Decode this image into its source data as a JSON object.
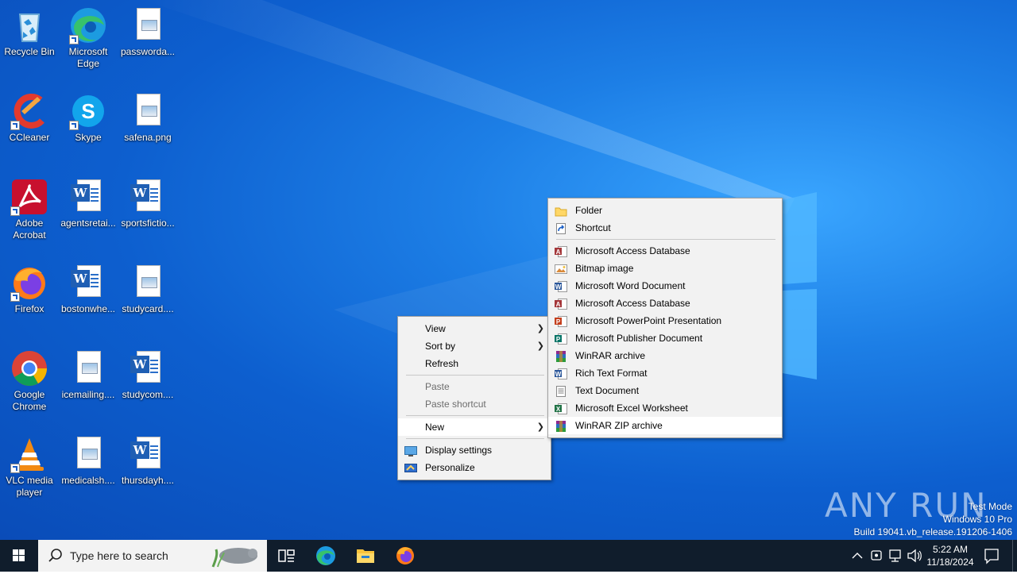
{
  "desktop": {
    "icons": [
      {
        "label": "Recycle Bin",
        "icon": "recycle-bin-icon"
      },
      {
        "label": "Microsoft Edge",
        "icon": "edge-icon"
      },
      {
        "label": "passworda...",
        "icon": "image-file-icon"
      },
      {
        "label": "CCleaner",
        "icon": "ccleaner-icon"
      },
      {
        "label": "Skype",
        "icon": "skype-icon"
      },
      {
        "label": "safena.png",
        "icon": "image-file-icon"
      },
      {
        "label": "Adobe Acrobat",
        "icon": "acrobat-icon"
      },
      {
        "label": "agentsretai...",
        "icon": "word-doc-icon"
      },
      {
        "label": "sportsfictio...",
        "icon": "word-doc-icon"
      },
      {
        "label": "Firefox",
        "icon": "firefox-icon"
      },
      {
        "label": "bostonwhe...",
        "icon": "word-doc-icon"
      },
      {
        "label": "studycard....",
        "icon": "image-file-icon"
      },
      {
        "label": "Google Chrome",
        "icon": "chrome-icon"
      },
      {
        "label": "icemailing....",
        "icon": "image-file-icon"
      },
      {
        "label": "studycom....",
        "icon": "word-doc-icon"
      },
      {
        "label": "VLC media player",
        "icon": "vlc-icon"
      },
      {
        "label": "medicalsh....",
        "icon": "image-file-icon"
      },
      {
        "label": "thursdayh....",
        "icon": "word-doc-icon"
      }
    ]
  },
  "context_menu": {
    "items": [
      {
        "label": "View"
      },
      {
        "label": "Sort by"
      },
      {
        "label": "Refresh"
      },
      {
        "label": "Paste"
      },
      {
        "label": "Paste shortcut"
      },
      {
        "label": "New"
      },
      {
        "label": "Display settings"
      },
      {
        "label": "Personalize"
      }
    ]
  },
  "new_submenu": {
    "items": [
      {
        "label": "Folder",
        "icon": "folder-icon"
      },
      {
        "label": "Shortcut",
        "icon": "shortcut-icon"
      },
      {
        "label": "Microsoft Access Database",
        "icon": "access-icon"
      },
      {
        "label": "Bitmap image",
        "icon": "bitmap-icon"
      },
      {
        "label": "Microsoft Word Document",
        "icon": "word-icon"
      },
      {
        "label": "Microsoft Access Database",
        "icon": "access-icon"
      },
      {
        "label": "Microsoft PowerPoint Presentation",
        "icon": "powerpoint-icon"
      },
      {
        "label": "Microsoft Publisher Document",
        "icon": "publisher-icon"
      },
      {
        "label": "WinRAR archive",
        "icon": "winrar-icon"
      },
      {
        "label": "Rich Text Format",
        "icon": "rtf-icon"
      },
      {
        "label": "Text Document",
        "icon": "text-doc-icon"
      },
      {
        "label": "Microsoft Excel Worksheet",
        "icon": "excel-icon"
      },
      {
        "label": "WinRAR ZIP archive",
        "icon": "winrar-zip-icon"
      }
    ]
  },
  "watermark": {
    "brand": "ANY RUN",
    "line1": "Test Mode",
    "line2": "Windows 10 Pro",
    "line3": "Build 19041.vb_release.191206-1406"
  },
  "taskbar": {
    "search_placeholder": "Type here to search",
    "time": "5:22 AM",
    "date": "11/18/2024"
  }
}
